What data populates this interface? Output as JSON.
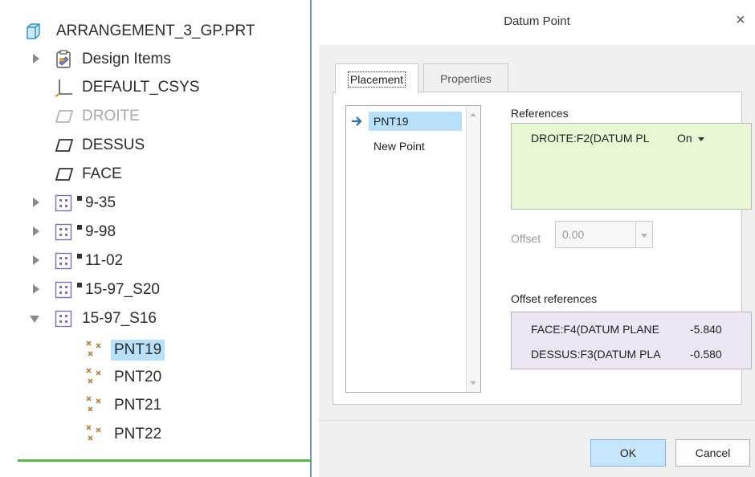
{
  "tree": {
    "root": "ARRANGEMENT_3_GP.PRT",
    "items": [
      {
        "label": "Design Items",
        "icon": "design-items-icon",
        "expand": "collapsed"
      },
      {
        "label": "DEFAULT_CSYS",
        "icon": "csys-icon"
      },
      {
        "label": "DROITE",
        "icon": "datum-plane-icon",
        "state": "disabled"
      },
      {
        "label": "DESSUS",
        "icon": "datum-plane-icon"
      },
      {
        "label": "FACE",
        "icon": "datum-plane-icon"
      },
      {
        "label": "9-35",
        "icon": "component-icon",
        "expand": "collapsed",
        "marker": true
      },
      {
        "label": "9-98",
        "icon": "component-icon",
        "expand": "collapsed",
        "marker": true
      },
      {
        "label": "11-02",
        "icon": "component-icon",
        "expand": "collapsed",
        "marker": true
      },
      {
        "label": "15-97_S20",
        "icon": "component-icon",
        "expand": "collapsed",
        "marker": true
      },
      {
        "label": "15-97_S16",
        "icon": "component-icon",
        "expand": "expanded"
      },
      {
        "label": "PNT19",
        "icon": "datum-point-icon",
        "state": "selected"
      },
      {
        "label": "PNT20",
        "icon": "datum-point-icon"
      },
      {
        "label": "PNT21",
        "icon": "datum-point-icon"
      },
      {
        "label": "PNT22",
        "icon": "datum-point-icon"
      }
    ]
  },
  "dialog": {
    "title": "Datum Point",
    "close": "×",
    "tabs": [
      "Placement",
      "Properties"
    ],
    "active_tab": "Placement",
    "points": [
      {
        "label": "PNT19",
        "selected": true
      },
      {
        "label": "New Point"
      }
    ],
    "references_label": "References",
    "references": [
      {
        "ref": "DROITE:F2(DATUM PL",
        "mode": "On"
      }
    ],
    "offset_label": "Offset",
    "offset_value": "0.00",
    "offset_refs_label": "Offset references",
    "offset_refs": [
      {
        "ref": "FACE:F4(DATUM PLANE",
        "value": "-5.840"
      },
      {
        "ref": "DESSUS:F3(DATUM PLA",
        "value": "-0.580"
      }
    ],
    "ok_label": "OK",
    "cancel_label": "Cancel"
  },
  "colors": {
    "selection": "#b9e0fb",
    "references_bg": "#e8f7d4",
    "offset_refs_bg": "#ece6f6",
    "ok_bg": "#c5e6fb",
    "tree_border": "#6f95c7",
    "tree_footer_line": "#58b947"
  }
}
